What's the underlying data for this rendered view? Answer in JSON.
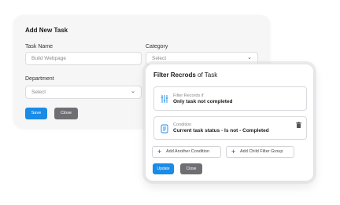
{
  "add_task": {
    "title": "Add New Task",
    "task_name_label": "Task Name",
    "task_name_placeholder": "Build Webpage",
    "category_label": "Category",
    "category_value": "Select",
    "department_label": "Department",
    "department_value": "Select",
    "save_label": "Save",
    "close_label": "Close"
  },
  "filter": {
    "title_bold": "Filter Recrods",
    "title_rest": " of Task",
    "rule1_caption": "Filter Records if",
    "rule1_value": "Only task not completed",
    "rule2_caption": "Condition",
    "rule2_value": "Current task status - Is not - Completed",
    "add_condition_label": "Add Another Condition",
    "add_group_label": "Add Child Filter Group",
    "update_label": "Update",
    "close_label": "Close"
  },
  "colors": {
    "primary": "#1a8be6",
    "secondary": "#6f6f73",
    "icon_accent": "#1a8be6"
  },
  "icons": [
    "sliders-icon",
    "list-doc-icon",
    "trash-icon",
    "chevron-down-icon",
    "plus-icon"
  ]
}
